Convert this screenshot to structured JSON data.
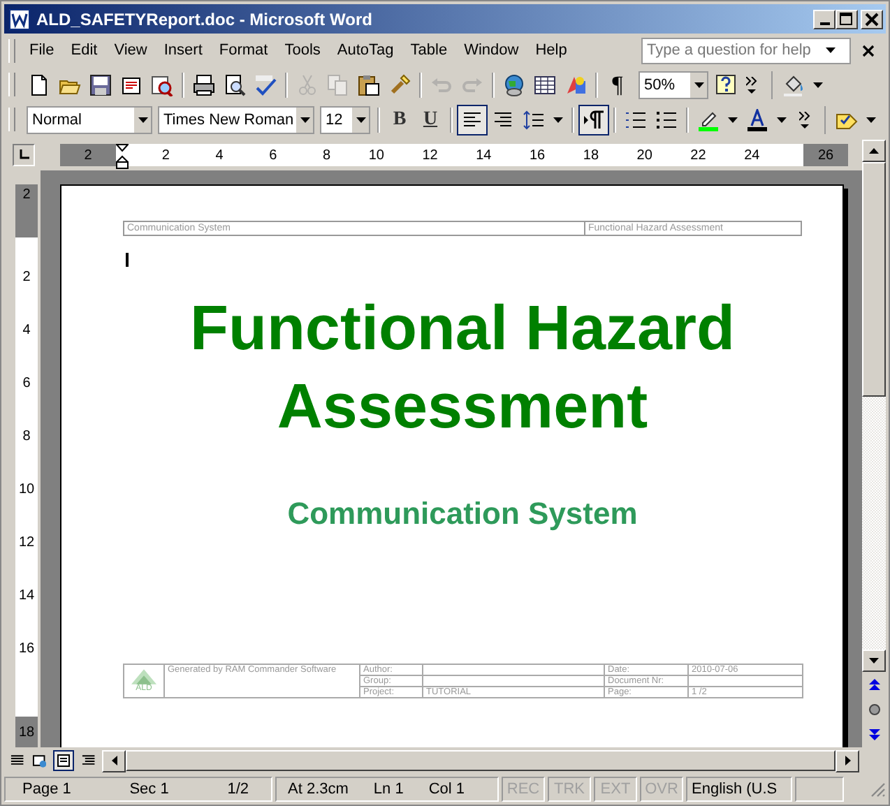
{
  "window": {
    "title": "ALD_SAFETYReport.doc - Microsoft Word"
  },
  "menu": [
    {
      "label": "File"
    },
    {
      "label": "Edit"
    },
    {
      "label": "View"
    },
    {
      "label": "Insert"
    },
    {
      "label": "Format"
    },
    {
      "label": "Tools"
    },
    {
      "label": "AutoTag"
    },
    {
      "label": "Table"
    },
    {
      "label": "Window"
    },
    {
      "label": "Help"
    }
  ],
  "help_box": {
    "placeholder": "Type a question for help"
  },
  "standard_toolbar": {
    "groups": [
      [
        {
          "kind": "new",
          "disabled": false
        },
        {
          "kind": "open",
          "disabled": false
        },
        {
          "kind": "save",
          "disabled": false
        },
        {
          "kind": "mail",
          "disabled": false
        },
        {
          "kind": "research",
          "disabled": false
        }
      ],
      [
        {
          "kind": "print",
          "disabled": false
        },
        {
          "kind": "preview",
          "disabled": false
        },
        {
          "kind": "spelling",
          "disabled": false
        }
      ],
      [
        {
          "kind": "cut",
          "disabled": true
        },
        {
          "kind": "copy",
          "disabled": true
        },
        {
          "kind": "paste",
          "disabled": false
        },
        {
          "kind": "painter",
          "disabled": false
        }
      ],
      [
        {
          "kind": "undo",
          "disabled": true
        },
        {
          "kind": "redo",
          "disabled": true
        }
      ],
      [
        {
          "kind": "web",
          "disabled": false
        },
        {
          "kind": "table",
          "disabled": false
        },
        {
          "kind": "drawing",
          "disabled": false
        }
      ]
    ],
    "pilcrow": "¶",
    "zoom": "50%"
  },
  "formatting_toolbar": {
    "style": "Normal",
    "font": "Times New Roman",
    "size": "12",
    "bold": "B",
    "underline": "U",
    "buttons": [
      {
        "kind": "align-left",
        "pressed": true
      },
      {
        "kind": "align-right",
        "pressed": false
      },
      {
        "kind": "line-spacing",
        "pressed": false
      },
      {
        "kind": "ltr",
        "pressed": true
      },
      {
        "kind": "numbering",
        "pressed": false
      },
      {
        "kind": "bullets",
        "pressed": false
      }
    ]
  },
  "ruler": {
    "left_margin_label": "2",
    "numbers": [
      "2",
      "4",
      "6",
      "8",
      "10",
      "12",
      "14",
      "16",
      "18",
      "20",
      "22",
      "24"
    ],
    "right_margin_label": "26"
  },
  "vertical_ruler": {
    "top_margin_label": "2",
    "numbers": [
      "2",
      "4",
      "6",
      "8",
      "10",
      "12",
      "14",
      "16"
    ],
    "bottom_label": "18"
  },
  "document": {
    "header": {
      "left": "Communication System",
      "right": "Functional Hazard Assessment"
    },
    "title": "Functional Hazard Assessment",
    "subtitle": "Communication System",
    "footer": {
      "logo": "ALD",
      "generated": "Generated by RAM Commander Software",
      "rows": [
        {
          "label": "Author:",
          "value": "",
          "label2": "Date:",
          "value2": "2010-07-06"
        },
        {
          "label": "Group:",
          "value": "",
          "label2": "Document Nr:",
          "value2": ""
        },
        {
          "label": "Project:",
          "value": "TUTORIAL",
          "label2": "Page:",
          "value2": "1 /2"
        }
      ]
    }
  },
  "status_bar": {
    "page": "Page 1",
    "section": "Sec 1",
    "pages": "1/2",
    "at": "At 2.3cm",
    "line": "Ln 1",
    "column": "Col 1",
    "modes": [
      {
        "label": "REC",
        "enabled": false
      },
      {
        "label": "TRK",
        "enabled": false
      },
      {
        "label": "EXT",
        "enabled": false
      },
      {
        "label": "OVR",
        "enabled": false
      }
    ],
    "language": "English (U.S"
  }
}
